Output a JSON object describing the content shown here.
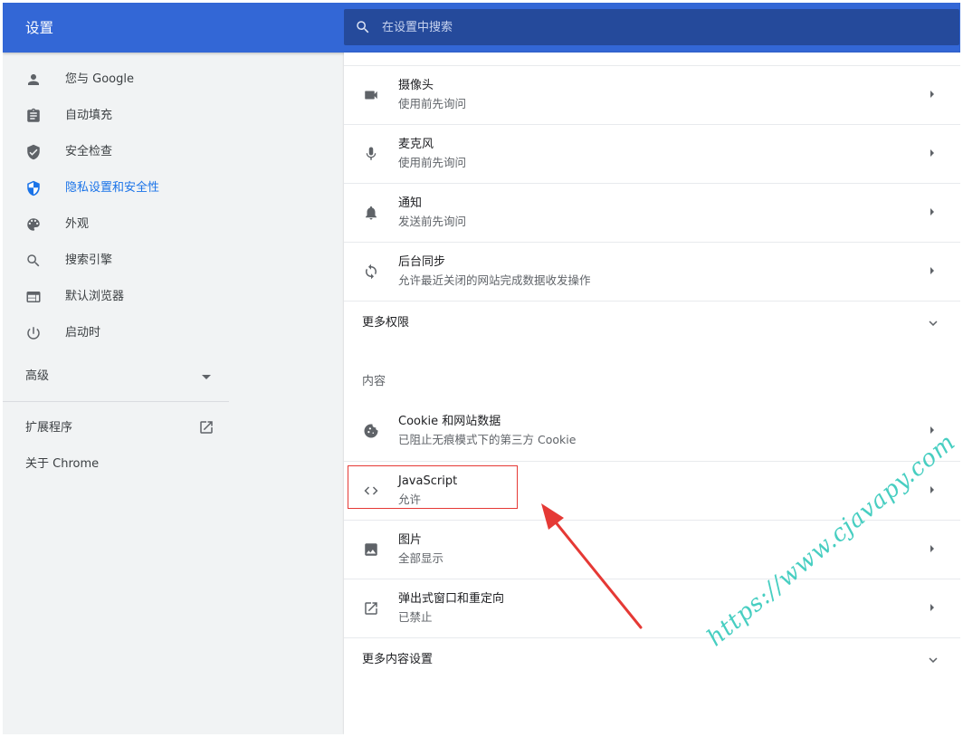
{
  "header": {
    "title": "设置",
    "search_placeholder": "在设置中搜索"
  },
  "sidebar": {
    "items": [
      {
        "label": "您与 Google",
        "icon": "person-icon"
      },
      {
        "label": "自动填充",
        "icon": "clipboard-icon"
      },
      {
        "label": "安全检查",
        "icon": "shield-check-icon"
      },
      {
        "label": "隐私设置和安全性",
        "icon": "shield-privacy-icon",
        "active": true
      },
      {
        "label": "外观",
        "icon": "palette-icon"
      },
      {
        "label": "搜索引擎",
        "icon": "search-icon"
      },
      {
        "label": "默认浏览器",
        "icon": "browser-window-icon"
      },
      {
        "label": "启动时",
        "icon": "power-icon"
      }
    ],
    "advanced_label": "高级",
    "extensions_label": "扩展程序",
    "about_label": "关于 Chrome"
  },
  "main": {
    "permissions": [
      {
        "title": "摄像头",
        "subtitle": "使用前先询问",
        "icon": "camera-icon"
      },
      {
        "title": "麦克风",
        "subtitle": "使用前先询问",
        "icon": "microphone-icon"
      },
      {
        "title": "通知",
        "subtitle": "发送前先询问",
        "icon": "bell-icon"
      },
      {
        "title": "后台同步",
        "subtitle": "允许最近关闭的网站完成数据收发操作",
        "icon": "sync-icon"
      }
    ],
    "more_permissions_label": "更多权限",
    "content_header": "内容",
    "content": [
      {
        "title": "Cookie 和网站数据",
        "subtitle": "已阻止无痕模式下的第三方 Cookie",
        "icon": "cookie-icon"
      },
      {
        "title": "JavaScript",
        "subtitle": "允许",
        "icon": "code-icon"
      },
      {
        "title": "图片",
        "subtitle": "全部显示",
        "icon": "image-icon"
      },
      {
        "title": "弹出式窗口和重定向",
        "subtitle": "已禁止",
        "icon": "open-in-new-icon"
      }
    ],
    "more_content_label": "更多内容设置"
  },
  "watermark": "https://www.cjavapy.com",
  "colors": {
    "header_bg": "#3367d6",
    "search_bg": "#254a9b",
    "active_nav": "#1a73e8",
    "annotation": "#e53935",
    "watermark": "#34c9bb"
  }
}
